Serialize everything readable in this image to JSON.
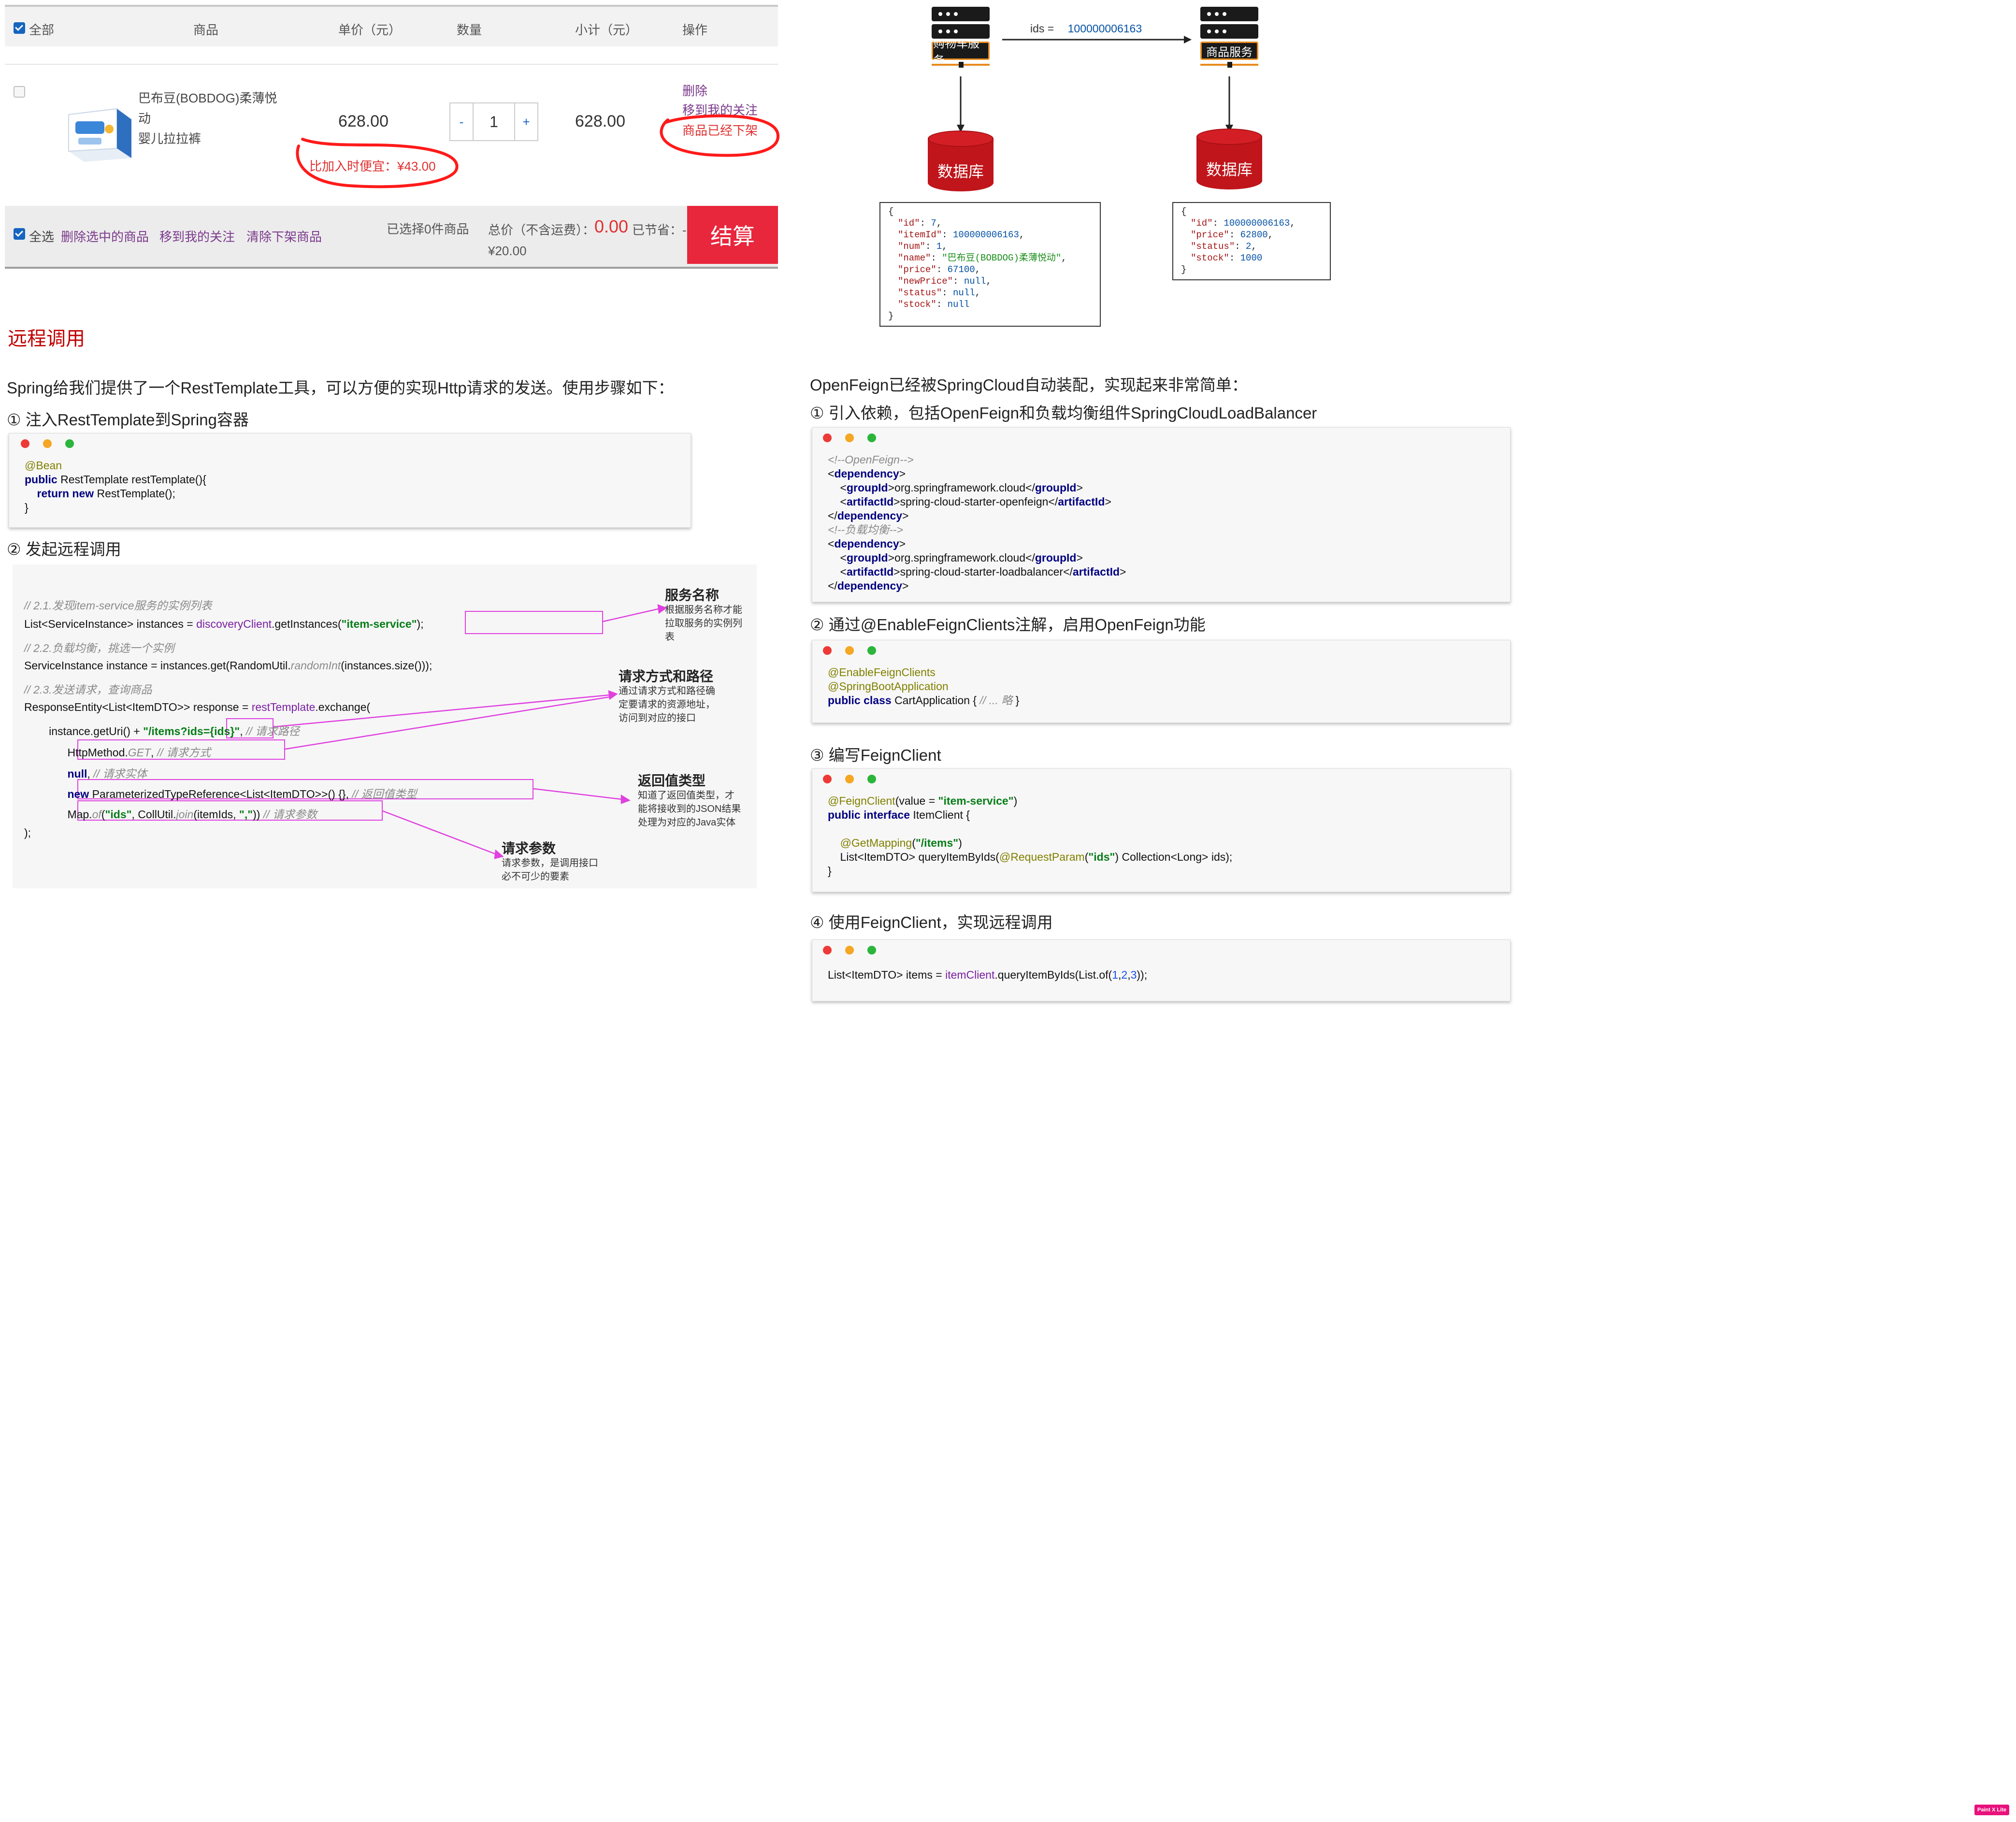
{
  "cart": {
    "header": {
      "select_all": "全部",
      "product": "商品",
      "unit_price": "单价（元）",
      "quantity": "数量",
      "subtotal": "小计（元）",
      "action": "操作"
    },
    "item": {
      "name_line1": "巴布豆(BOBDOG)柔薄悦动",
      "name_line2": "婴儿拉拉裤",
      "unit_price": "628.00",
      "cheaper_note": "比加入时便宜：¥43.00",
      "qty_minus": "-",
      "qty_value": "1",
      "qty_plus": "+",
      "subtotal": "628.00",
      "op_delete": "删除",
      "op_move": "移到我的关注",
      "op_offline": "商品已经下架"
    },
    "footer": {
      "select_all": "全选",
      "delete_selected": "删除选中的商品",
      "move_to_follow": "移到我的关注",
      "clear_offline": "清除下架商品",
      "selected_count": "已选择0件商品",
      "total_label": "总价（不含运费）：",
      "total_value": "0.00",
      "saved_label": "已节省：-",
      "saved_value": "¥20.00",
      "checkout": "结算"
    },
    "colors": {
      "accent": "#e8263c",
      "link": "#7b3a8c",
      "alert": "#e03030"
    }
  },
  "diagram": {
    "cart_service": "购物车服务",
    "item_service": "商品服务",
    "request_label": "ids = ",
    "request_value": "100000006163",
    "db_left": "数据库",
    "db_right": "数据库",
    "cart_json": [
      {
        "k": "{",
        "t": "p"
      },
      {
        "k": "\"id\"",
        "v": "7",
        "t": "n"
      },
      {
        "k": "\"itemId\"",
        "v": "100000006163",
        "t": "n"
      },
      {
        "k": "\"num\"",
        "v": "1",
        "t": "n"
      },
      {
        "k": "\"name\"",
        "v": "\"巴布豆(BOBDOG)柔薄悦动\"",
        "t": "s"
      },
      {
        "k": "\"price\"",
        "v": "67100",
        "t": "n"
      },
      {
        "k": "\"newPrice\"",
        "v": "null",
        "t": "n"
      },
      {
        "k": "\"status\"",
        "v": "null",
        "t": "n"
      },
      {
        "k": "\"stock\"",
        "v": "null",
        "t": "n",
        "last": true
      },
      {
        "k": "}",
        "t": "p"
      }
    ],
    "item_json": [
      {
        "k": "{",
        "t": "p"
      },
      {
        "k": "\"id\"",
        "v": "100000006163",
        "t": "n"
      },
      {
        "k": "\"price\"",
        "v": "62800",
        "t": "n"
      },
      {
        "k": "\"status\"",
        "v": "2",
        "t": "n"
      },
      {
        "k": "\"stock\"",
        "v": "1000",
        "t": "n",
        "last": true
      },
      {
        "k": "}",
        "t": "p"
      }
    ]
  },
  "left": {
    "section_title": "远程调用",
    "intro": "Spring给我们提供了一个RestTemplate工具，可以方便的实现Http请求的发送。使用步骤如下：",
    "step1": "①  注入RestTemplate到Spring容器",
    "step2": "②  发起远程调用",
    "code1": [
      [
        [
          "@Bean",
          "c-ann"
        ]
      ],
      [
        [
          "public ",
          "c-kw"
        ],
        [
          "RestTemplate restTemplate(){",
          ""
        ]
      ],
      [
        [
          "    return ",
          "c-kw"
        ],
        [
          "new ",
          "c-kw"
        ],
        [
          "RestTemplate();",
          ""
        ]
      ],
      [
        [
          "}",
          ""
        ]
      ]
    ],
    "remote_lines": [
      [
        [
          "// 2.1.发现item-service服务的实例列表",
          "c-cm"
        ]
      ],
      [
        [
          "List<ServiceInstance> instances = ",
          ""
        ],
        [
          "discoveryClient",
          "c-fn"
        ],
        [
          ".getInstances(",
          ""
        ],
        [
          "\"item-service\"",
          "c-str"
        ],
        [
          ");",
          ""
        ]
      ],
      [
        [
          "// 2.2.负载均衡，挑选一个实例",
          "c-cm"
        ]
      ],
      [
        [
          "ServiceInstance instance = instances.get(RandomUtil.",
          ""
        ],
        [
          "randomInt",
          "c-cm"
        ],
        [
          "(instances.size()));",
          ""
        ]
      ],
      [
        [
          "// 2.3.发送请求，查询商品",
          "c-cm"
        ]
      ],
      [
        [
          "ResponseEntity<List<ItemDTO>> response = ",
          ""
        ],
        [
          "restTemplate",
          "c-fn"
        ],
        [
          ".exchange(",
          ""
        ]
      ],
      [
        [
          "        instance.getUri() + ",
          ""
        ],
        [
          "\"/items?ids={ids}\"",
          "c-str"
        ],
        [
          ", ",
          ""
        ],
        [
          "// 请求路径",
          "c-cm"
        ]
      ],
      [
        [
          "              HttpMethod.",
          ""
        ],
        [
          "GET",
          "c-cm"
        ],
        [
          ", ",
          ""
        ],
        [
          "// 请求方式",
          "c-cm"
        ]
      ],
      [
        [
          "              ",
          ""
        ],
        [
          "null",
          "c-kw"
        ],
        [
          ", ",
          ""
        ],
        [
          "// 请求实体",
          "c-cm"
        ]
      ],
      [
        [
          "              ",
          ""
        ],
        [
          "new ",
          "c-kw"
        ],
        [
          "ParameterizedTypeReference<List<ItemDTO>>() {}, ",
          ""
        ],
        [
          "// 返回值类型",
          "c-cm"
        ]
      ],
      [
        [
          "              Map.",
          ""
        ],
        [
          "of",
          "c-cm"
        ],
        [
          "(",
          ""
        ],
        [
          "\"ids\"",
          "c-str"
        ],
        [
          ", CollUtil.",
          ""
        ],
        [
          "join",
          "c-cm"
        ],
        [
          "(itemIds, ",
          ""
        ],
        [
          "\",\"",
          "c-str"
        ],
        [
          ")) ",
          ""
        ],
        [
          "// 请求参数",
          "c-cm"
        ]
      ],
      [
        [
          ");",
          ""
        ]
      ]
    ],
    "notes": {
      "service_title": "服务名称",
      "service_body": [
        "根据服务名称才能",
        "拉取服务的实例列",
        "表"
      ],
      "method_title": "请求方式和路径",
      "method_body": [
        "通过请求方式和路径确",
        "定要请求的资源地址，",
        "访问到对应的接口"
      ],
      "return_title": "返回值类型",
      "return_body": [
        "知道了返回值类型，才",
        "能将接收到的JSON结果",
        "处理为对应的Java实体"
      ],
      "param_title": "请求参数",
      "param_body": [
        "请求参数，是调用接口",
        "必不可少的要素"
      ]
    }
  },
  "right": {
    "intro": "OpenFeign已经被SpringCloud自动装配，实现起来非常简单：",
    "step1": "①  引入依赖，包括OpenFeign和负载均衡组件SpringCloudLoadBalancer",
    "step2": "②  通过@EnableFeignClients注解，启用OpenFeign功能",
    "step3": "③  编写FeignClient",
    "step4": "④  使用FeignClient，实现远程调用",
    "code1": [
      [
        [
          "<!--OpenFeign-->",
          "c-cm"
        ]
      ],
      [
        [
          "<",
          ""
        ],
        [
          "dependency",
          "c-tag"
        ],
        [
          ">",
          ""
        ]
      ],
      [
        [
          "    <",
          ""
        ],
        [
          "groupId",
          "c-tag"
        ],
        [
          ">org.springframework.cloud</",
          ""
        ],
        [
          "groupId",
          "c-tag"
        ],
        [
          ">",
          ""
        ]
      ],
      [
        [
          "    <",
          ""
        ],
        [
          "artifactId",
          "c-tag"
        ],
        [
          ">spring-cloud-starter-openfeign</",
          ""
        ],
        [
          "artifactId",
          "c-tag"
        ],
        [
          ">",
          ""
        ]
      ],
      [
        [
          "</",
          ""
        ],
        [
          "dependency",
          "c-tag"
        ],
        [
          ">",
          ""
        ]
      ],
      [
        [
          "<!--负载均衡-->",
          "c-cm"
        ]
      ],
      [
        [
          "<",
          ""
        ],
        [
          "dependency",
          "c-tag"
        ],
        [
          ">",
          ""
        ]
      ],
      [
        [
          "    <",
          ""
        ],
        [
          "groupId",
          "c-tag"
        ],
        [
          ">org.springframework.cloud</",
          ""
        ],
        [
          "groupId",
          "c-tag"
        ],
        [
          ">",
          ""
        ]
      ],
      [
        [
          "    <",
          ""
        ],
        [
          "artifactId",
          "c-tag"
        ],
        [
          ">spring-cloud-starter-loadbalancer</",
          ""
        ],
        [
          "artifactId",
          "c-tag"
        ],
        [
          ">",
          ""
        ]
      ],
      [
        [
          "</",
          ""
        ],
        [
          "dependency",
          "c-tag"
        ],
        [
          ">",
          ""
        ]
      ]
    ],
    "code2": [
      [
        [
          "@EnableFeignClients",
          "c-ann"
        ]
      ],
      [
        [
          "@SpringBootApplication",
          "c-ann"
        ]
      ],
      [
        [
          "public class ",
          "c-kw"
        ],
        [
          "CartApplication { ",
          ""
        ],
        [
          "// ... 略",
          "c-cm"
        ],
        [
          " }",
          ""
        ]
      ]
    ],
    "code3": [
      [
        [
          "@FeignClient",
          "c-ann"
        ],
        [
          "(value = ",
          ""
        ],
        [
          "\"item-service\"",
          "c-str"
        ],
        [
          ")",
          ""
        ]
      ],
      [
        [
          "public interface ",
          "c-kw"
        ],
        [
          "ItemClient {",
          ""
        ]
      ],
      [
        [
          "",
          ""
        ]
      ],
      [
        [
          "    ",
          ""
        ],
        [
          "@GetMapping",
          "c-ann"
        ],
        [
          "(",
          ""
        ],
        [
          "\"/items\"",
          "c-str"
        ],
        [
          ")",
          ""
        ]
      ],
      [
        [
          "    List<ItemDTO> queryItemByIds(",
          ""
        ],
        [
          "@RequestParam",
          "c-ann"
        ],
        [
          "(",
          ""
        ],
        [
          "\"ids\"",
          "c-str"
        ],
        [
          ") Collection<Long> ids);",
          ""
        ]
      ],
      [
        [
          "}",
          ""
        ]
      ]
    ],
    "code4": [
      [
        [
          "List<ItemDTO> items = ",
          ""
        ],
        [
          "itemClient",
          "c-fn"
        ],
        [
          ".queryItemByIds(List.of(",
          ""
        ],
        [
          "1",
          "c-num"
        ],
        [
          ",",
          ""
        ],
        [
          "2",
          "c-num"
        ],
        [
          ",",
          ""
        ],
        [
          "3",
          "c-num"
        ],
        [
          "));",
          ""
        ]
      ]
    ]
  },
  "watermark": "Paint X Lite"
}
